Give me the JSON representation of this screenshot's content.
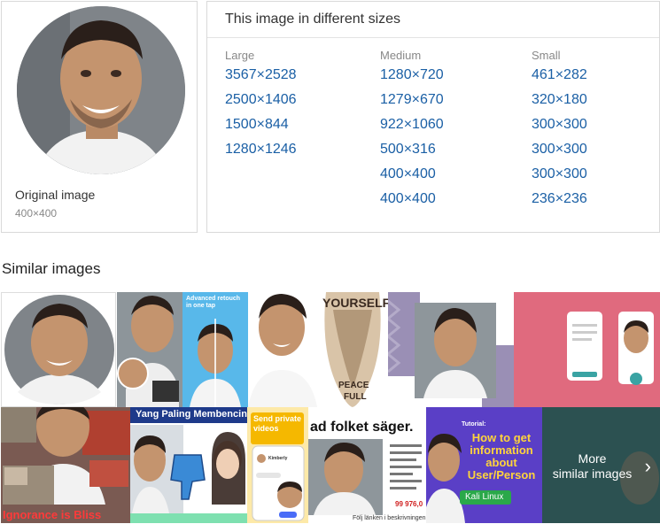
{
  "original": {
    "title": "Original image",
    "size": "400×400"
  },
  "sizes": {
    "title": "This image in different sizes",
    "columns": [
      {
        "label": "Large",
        "items": [
          "3567×2528",
          "2500×1406",
          "1500×844",
          "1280×1246"
        ]
      },
      {
        "label": "Medium",
        "items": [
          "1280×720",
          "1279×670",
          "922×1060",
          "500×316",
          "400×400",
          "400×400"
        ]
      },
      {
        "label": "Small",
        "items": [
          "461×282",
          "320×180",
          "300×300",
          "300×300",
          "300×300",
          "236×236"
        ]
      }
    ]
  },
  "similar": {
    "heading": "Similar images",
    "tile_texts": {
      "retouch": "Advanced retouch in one tap",
      "yourself": "YOURSELF",
      "peace": "PEACE",
      "full": "FULL",
      "ignorance": "Ignorance is Bliss",
      "paling": "Yang Paling Membencinya",
      "send": "Send private videos",
      "kimberly": "Kimberly",
      "folket": "ad folket säger.",
      "folj": "Följ länken i beskrivningen",
      "price": "99 976,0",
      "tutorial": "Tutorial:",
      "howto": "How to get information about User/Person",
      "kali": "Kali Linux"
    },
    "more_label": "More\nsimilar images"
  },
  "colors": {
    "link": "#1a5fa5",
    "text": "#333333",
    "muted": "#888888",
    "border": "#d9d9d9"
  }
}
